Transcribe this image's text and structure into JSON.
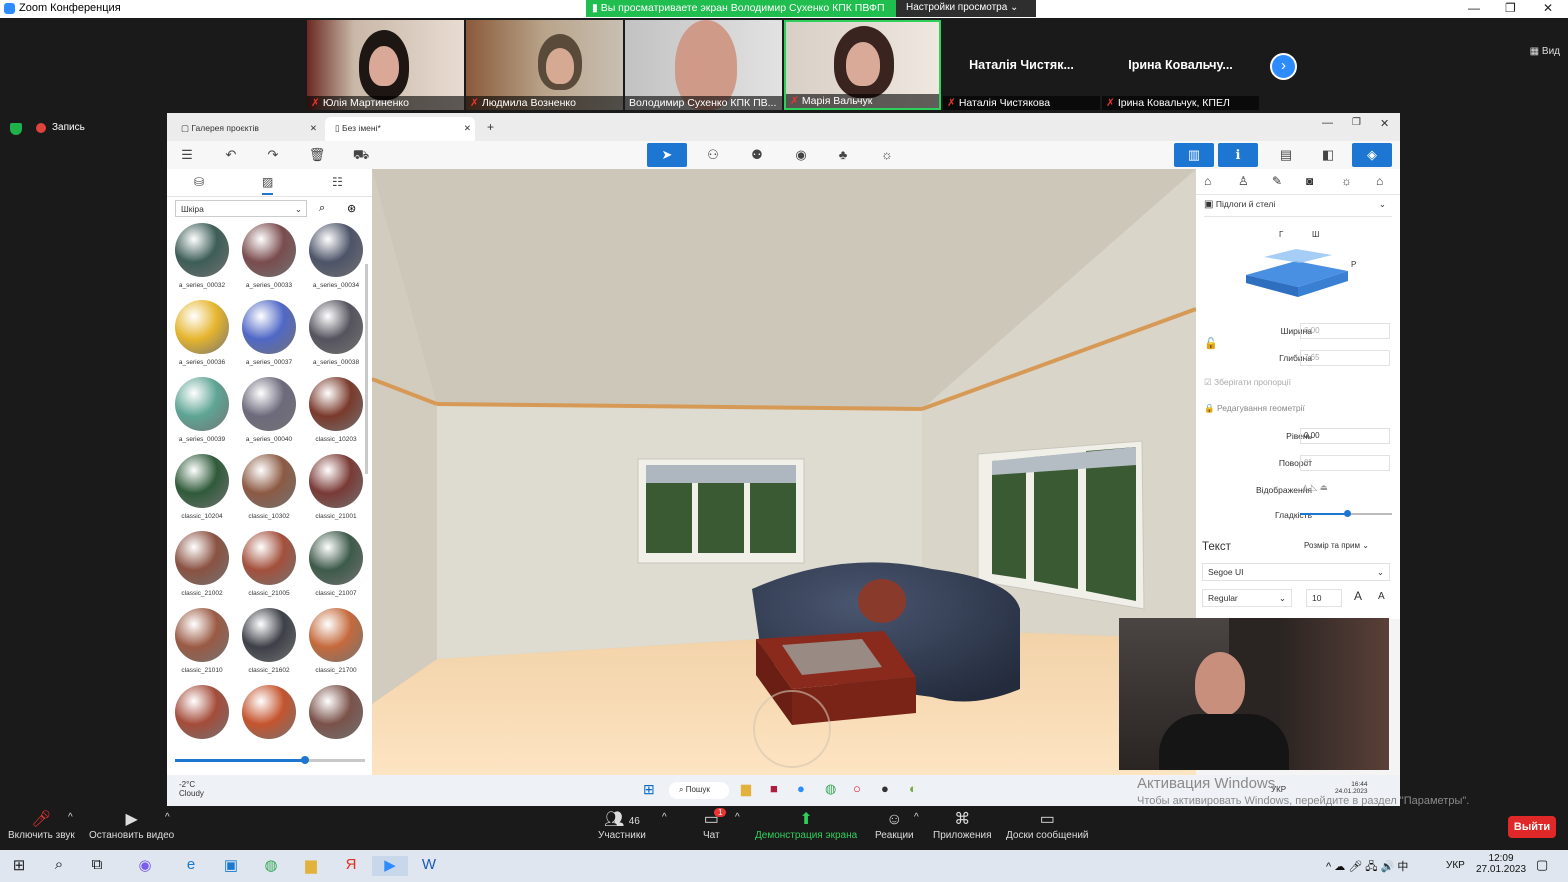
{
  "zoom": {
    "window_title": "Zoom Конференция",
    "banner_text": "Вы просматриваете экран Володимир Сухенко КПК ПВФП",
    "banner_settings": "Настройки просмотра",
    "view_label": "Вид",
    "record_label": "Запись",
    "participants": [
      {
        "name": "Юлія Мартиненко",
        "muted": true
      },
      {
        "name": "Людмила Возненко",
        "muted": true
      },
      {
        "name": "Володимир Сухенко КПК ПВ...",
        "muted": false
      },
      {
        "name": "Марія Вальчук",
        "muted": true
      },
      {
        "name": "Наталія Чистякова",
        "title": "Наталія Чистяк...",
        "muted": true
      },
      {
        "name": "Ірина Ковальчук, КПЕЛ",
        "title": "Ірина Ковальчу...",
        "muted": true
      }
    ],
    "controls": {
      "audio": "Включить звук",
      "video": "Остановить видео",
      "participants": "Участники",
      "participants_count": "46",
      "chat": "Чат",
      "chat_badge": "1",
      "share": "Демонстрация экрана",
      "reactions": "Реакции",
      "apps": "Приложения",
      "whiteboards": "Доски сообщений",
      "leave": "Выйти"
    },
    "watermark": "Активация Windows",
    "watermark_sub": "Чтобы активировать Windows, перейдите в раздел \"Параметры\"."
  },
  "app": {
    "tabs": [
      {
        "label": "Галерея проєктів"
      },
      {
        "label": "Без імені*"
      }
    ],
    "filter_value": "Шкіра",
    "materials": [
      "a_series_00032",
      "a_series_00033",
      "a_series_00034",
      "a_series_00036",
      "a_series_00037",
      "a_series_00038",
      "a_series_00039",
      "a_series_00040",
      "classic_10203",
      "classic_10204",
      "classic_10302",
      "classic_21001",
      "classic_21002",
      "classic_21005",
      "classic_21007",
      "classic_21010",
      "classic_21602",
      "classic_21700",
      "",
      "",
      ""
    ],
    "material_colors": [
      "#3d5d56",
      "#7a4c4e",
      "#4d5468",
      "#e6b52e",
      "#5068c6",
      "#55545e",
      "#5ea595",
      "#6d6a7c",
      "#7a3a2c",
      "#2f5a3a",
      "#8c5a44",
      "#7a3a36",
      "#8a5242",
      "#a3503c",
      "#3d5a4a",
      "#9a5a44",
      "#3d4048",
      "#c46a3c",
      "#a44c3a",
      "#c4542e",
      "#7a524a"
    ],
    "right_panel": {
      "category": "Підлоги й стелі",
      "dim_labels": {
        "g": "Г",
        "sh": "Ш",
        "r": "Р"
      },
      "width_label": "Ширина",
      "width_value": "6.00",
      "depth_label": "Глибина",
      "depth_value": "7.65",
      "keep_proportions": "Зберігати пропорції",
      "edit_geometry": "Редагування геометрії",
      "level_label": "Рівень",
      "level_value": "0.00",
      "rotation_label": "Поворот",
      "rotation_value": "0°",
      "display_label": "Відображення",
      "smoothness_label": "Гладкість",
      "text_section": "Текст",
      "text_size_dropdown": "Розмір та прим",
      "font": "Segoe UI",
      "font_style": "Regular",
      "font_size": "10"
    },
    "taskbar": {
      "weather_temp": "-2°C",
      "weather_desc": "Cloudy",
      "search": "Пошук",
      "lang": "УКР",
      "time": "16:44",
      "date": "24.01.2023"
    }
  },
  "windows": {
    "lang": "УКР",
    "time": "12:09",
    "date": "27.01.2023"
  }
}
